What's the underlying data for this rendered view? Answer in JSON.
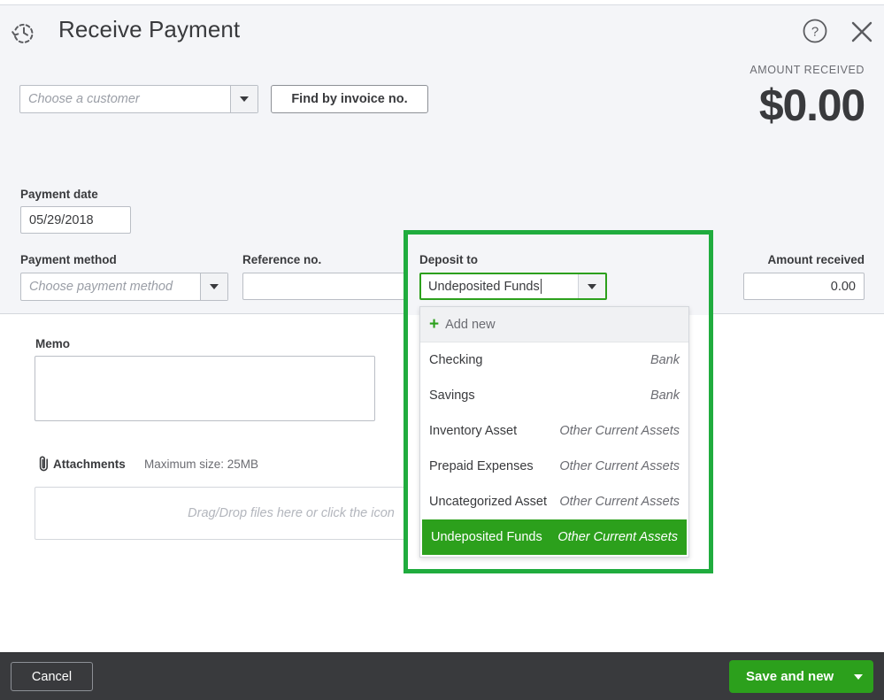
{
  "header": {
    "title": "Receive Payment",
    "history_icon": "history-clock-icon",
    "help_icon": "help-circle-icon",
    "close_icon": "close-x-icon"
  },
  "amount_summary": {
    "label": "AMOUNT RECEIVED",
    "value": "$0.00"
  },
  "customer": {
    "placeholder": "Choose a customer",
    "value": "",
    "caret_icon": "chevron-down-icon"
  },
  "find_by_invoice": {
    "label": "Find by invoice no."
  },
  "payment_date": {
    "label": "Payment date",
    "value": "05/29/2018"
  },
  "payment_method": {
    "label": "Payment method",
    "placeholder": "Choose payment method",
    "value": "",
    "caret_icon": "chevron-down-icon"
  },
  "reference_no": {
    "label": "Reference no.",
    "value": ""
  },
  "deposit_to": {
    "label": "Deposit to",
    "value": "Undeposited Funds",
    "caret_icon": "chevron-down-icon",
    "options": [
      {
        "name": "Add new",
        "type": "",
        "kind": "action",
        "icon": "plus-icon"
      },
      {
        "name": "Checking",
        "type": "Bank",
        "kind": "item"
      },
      {
        "name": "Savings",
        "type": "Bank",
        "kind": "item"
      },
      {
        "name": "Inventory Asset",
        "type": "Other Current Assets",
        "kind": "item"
      },
      {
        "name": "Prepaid Expenses",
        "type": "Other Current Assets",
        "kind": "item"
      },
      {
        "name": "Uncategorized Asset",
        "type": "Other Current Assets",
        "kind": "item"
      },
      {
        "name": "Undeposited Funds",
        "type": "Other Current Assets",
        "kind": "item",
        "selected": true
      }
    ]
  },
  "amount_received_field": {
    "label": "Amount received",
    "value": "0.00"
  },
  "memo": {
    "label": "Memo",
    "value": ""
  },
  "attachments": {
    "label": "Attachments",
    "max_size": "Maximum size: 25MB",
    "dropzone_text": "Drag/Drop files here or click the icon",
    "clip_icon": "paperclip-icon"
  },
  "footer": {
    "cancel_label": "Cancel",
    "save_label": "Save and new",
    "save_caret_icon": "chevron-down-icon"
  },
  "colors": {
    "accent_green": "#2ca01c",
    "highlight_box_green": "#20ac3e",
    "panel_bg": "#f4f5f8",
    "footer_bg": "#393a3d",
    "text": "#393a3d",
    "muted_text": "#6b6c72"
  }
}
